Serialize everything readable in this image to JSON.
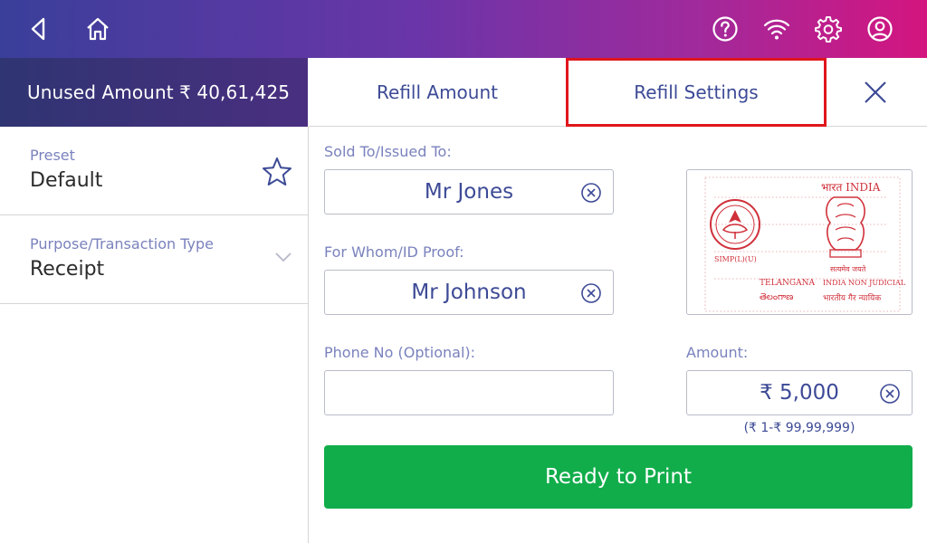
{
  "colors": {
    "accent": "#3d4a96",
    "primary_button": "#11ad4b",
    "highlight": "#e0161c",
    "label": "#7a82bd"
  },
  "header": {
    "icons": [
      "back-icon",
      "home-icon",
      "help-icon",
      "wifi-icon",
      "settings-icon",
      "account-icon"
    ]
  },
  "unused_amount": {
    "text": "Unused Amount ₹ 40,61,425"
  },
  "sidebar": {
    "preset": {
      "label": "Preset",
      "value": "Default"
    },
    "purpose": {
      "label": "Purpose/Transaction Type",
      "value": "Receipt"
    }
  },
  "tabs": {
    "refill_amount": "Refill Amount",
    "refill_settings": "Refill Settings"
  },
  "form": {
    "sold_to": {
      "label": "Sold To/Issued To:",
      "value": "Mr Jones"
    },
    "for_whom": {
      "label": "For Whom/ID Proof:",
      "value": "Mr Johnson"
    },
    "phone": {
      "label": "Phone No (Optional):",
      "value": ""
    },
    "amount": {
      "label": "Amount:",
      "value": "₹ 5,000",
      "range": "(₹ 1-₹ 99,99,999)"
    }
  },
  "stamp": {
    "top_right": "भारत INDIA",
    "left_caption": "SIMP(L)(U)",
    "emblem_caption": "सत्यमेव जयते",
    "bottom_left_1": "TELANGANA",
    "bottom_left_2": "తెలంగాణ",
    "bottom_right_1": "INDIA NON JUDICIAL",
    "bottom_right_2": "भारतीय गैर न्यायिक"
  },
  "actions": {
    "print_label": "Ready to Print"
  }
}
